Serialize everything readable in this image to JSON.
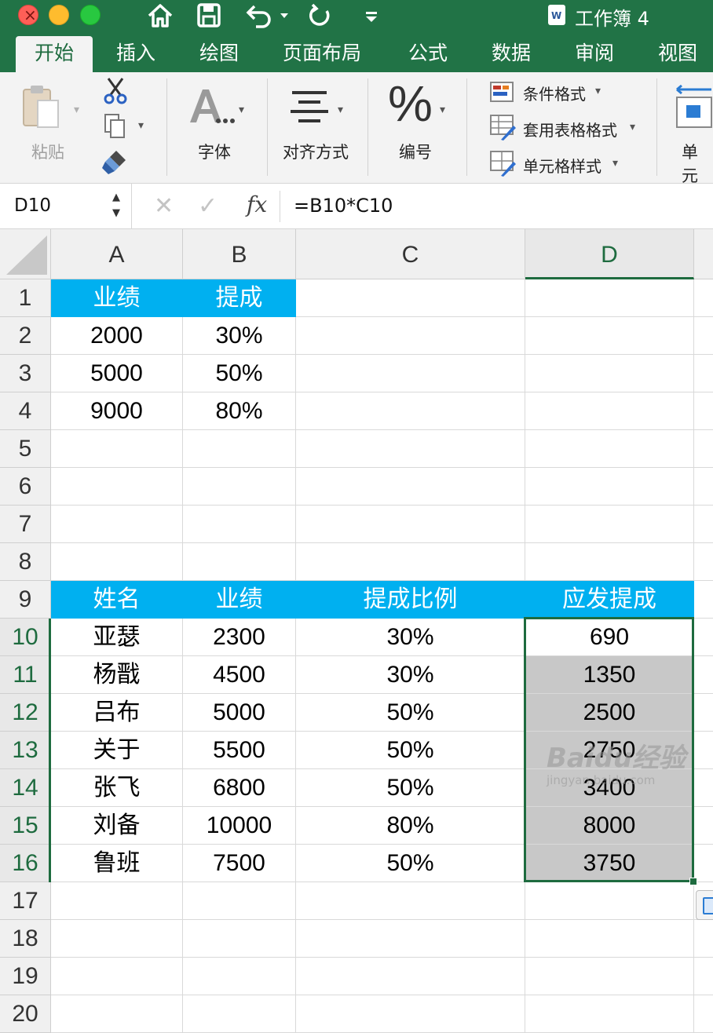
{
  "window": {
    "title": "工作簿 4",
    "accent": "#217346"
  },
  "tabs": [
    {
      "label": "开始",
      "active": true
    },
    {
      "label": "插入"
    },
    {
      "label": "绘图"
    },
    {
      "label": "页面布局"
    },
    {
      "label": "公式"
    },
    {
      "label": "数据"
    },
    {
      "label": "审阅"
    },
    {
      "label": "视图"
    }
  ],
  "ribbon": {
    "paste": "粘贴",
    "font": "字体",
    "align": "对齐方式",
    "number": "编号",
    "conditional_format": "条件格式",
    "table_format": "套用表格格式",
    "cell_style": "单元格样式",
    "cells": "单元"
  },
  "formula_bar": {
    "name_box": "D10",
    "formula": "=B10*C10",
    "fx": "fx"
  },
  "sheet": {
    "columns": [
      "A",
      "B",
      "C",
      "D"
    ],
    "selected_column": "D",
    "rows": [
      "1",
      "2",
      "3",
      "4",
      "5",
      "6",
      "7",
      "8",
      "9",
      "10",
      "11",
      "12",
      "13",
      "14",
      "15",
      "16",
      "17",
      "18",
      "19",
      "20"
    ],
    "header_fill": "#00b0f0",
    "table1": {
      "headers": [
        "业绩",
        "提成"
      ],
      "data": [
        [
          "2000",
          "30%"
        ],
        [
          "5000",
          "50%"
        ],
        [
          "9000",
          "80%"
        ]
      ]
    },
    "table2": {
      "headers": [
        "姓名",
        "业绩",
        "提成比例",
        "应发提成"
      ],
      "data": [
        [
          "亚瑟",
          "2300",
          "30%",
          "690"
        ],
        [
          "杨戬",
          "4500",
          "30%",
          "1350"
        ],
        [
          "吕布",
          "5000",
          "50%",
          "2500"
        ],
        [
          "关于",
          "5500",
          "50%",
          "2750"
        ],
        [
          "张飞",
          "6800",
          "50%",
          "3400"
        ],
        [
          "刘备",
          "10000",
          "80%",
          "8000"
        ],
        [
          "鲁班",
          "7500",
          "50%",
          "3750"
        ]
      ]
    },
    "selection": "D10:D16",
    "active_cell": "D10"
  },
  "watermark": {
    "main": "Baidu经验",
    "sub": "jingyan.baidu.com"
  }
}
